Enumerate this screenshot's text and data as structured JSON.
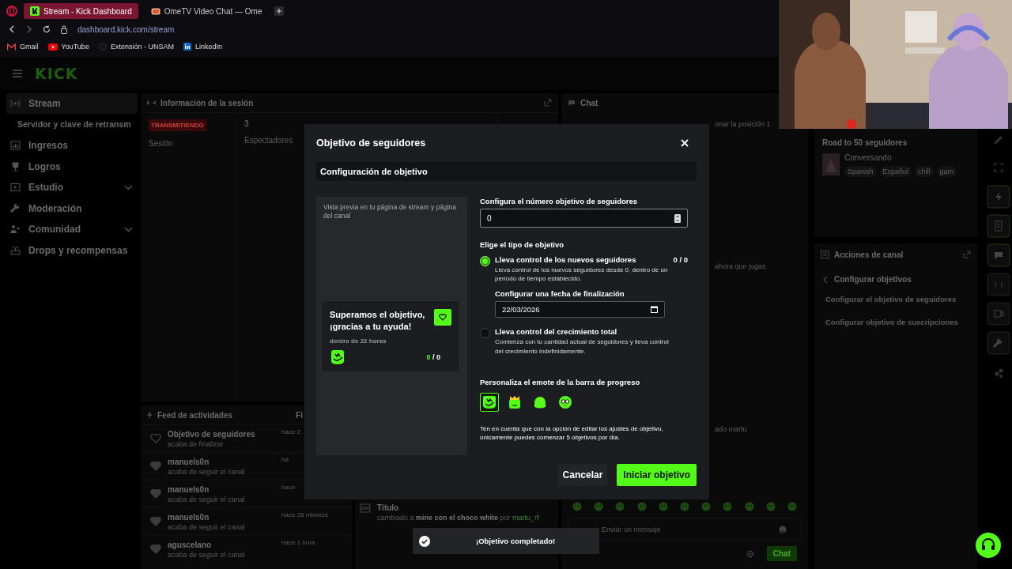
{
  "browser": {
    "tabs": [
      {
        "label": "Stream - Kick Dashboard",
        "selected": true
      },
      {
        "label": "OmeTV Video Chat — Ome",
        "selected": false
      }
    ],
    "url": "dashboard.kick.com/stream",
    "bookmarks": [
      {
        "label": "Gmail",
        "kind": "gmail"
      },
      {
        "label": "YouTube",
        "kind": "youtube"
      },
      {
        "label": "Extensión - UNSAM",
        "kind": "globe"
      },
      {
        "label": "LinkedIn",
        "kind": "linkedin"
      }
    ]
  },
  "header": {
    "logo": "KICK"
  },
  "sidebar": {
    "items": [
      {
        "label": "Stream",
        "kind": "broadcast",
        "selected": true,
        "children": [
          {
            "label": "Servidor y clave de retransm",
            "selected": false
          }
        ]
      },
      {
        "label": "Ingresos",
        "kind": "chart",
        "selected": false
      },
      {
        "label": "Logros",
        "kind": "trophy",
        "selected": false
      },
      {
        "label": "Estudio",
        "kind": "studio",
        "selected": false,
        "expanded": false
      },
      {
        "label": "Moderación",
        "kind": "wrench",
        "selected": false
      },
      {
        "label": "Comunidad",
        "kind": "people",
        "selected": false,
        "expanded": false
      },
      {
        "label": "Drops y recompensas",
        "kind": "gift",
        "selected": false
      }
    ]
  },
  "session": {
    "title": "Información de la sesión",
    "status": "TRANSMITIENDO",
    "status_label": "Sesión",
    "viewers": "3",
    "viewers_label": "Espectadores"
  },
  "feed": {
    "title": "Feed de actividades",
    "filter": "Fi",
    "items": [
      {
        "kind": "goal",
        "title": "Objetivo de seguidores",
        "subtitle": "acaba de finalizar",
        "time": "hace 2"
      },
      {
        "kind": "follow",
        "title": "manuels0n",
        "subtitle": "acaba de seguir el canal",
        "time": "ha"
      },
      {
        "kind": "follow",
        "title": "manuels0n",
        "subtitle": "acaba de seguir el canal",
        "time": "hace"
      },
      {
        "kind": "follow",
        "title": "manuels0n",
        "subtitle": "acaba de seguir el canal",
        "time": "hace 28 minutos"
      },
      {
        "kind": "follow",
        "title": "aguscelano",
        "subtitle": "acaba de seguir el canal",
        "time": "hace 1 hora"
      }
    ]
  },
  "stream_info": {
    "title": "Título",
    "change": "cambiado a **mine con el choco white** por",
    "user": "martu_rf"
  },
  "chat": {
    "title": "Chat",
    "messages": [
      "onar la posición 1",
      "ahora que jugas",
      "ado martu"
    ],
    "placeholder": "Enviar un mensaje",
    "send": "Chat"
  },
  "stream_card": {
    "title": "Road to 50 seguidores",
    "category": "Conversando",
    "tags": [
      "Spanish",
      "Español",
      "chill",
      "gam"
    ]
  },
  "channel_actions": {
    "title": "Acciones de canal",
    "back": "Configurar objetivos",
    "links": [
      "Configurar el objetivo de seguidores",
      "Configurar objetivo de suscripciones"
    ]
  },
  "modal": {
    "title": "Objetivo de seguidores",
    "section": "Configuración de objetivo",
    "preview": {
      "hint": "Vista previa en tu página de stream y página del canal",
      "title": "Superamos el objetivo, ¡gracias a tu ayuda!",
      "time": "dentro de 22 horas",
      "current": "0",
      "total": "/ 0"
    },
    "target": {
      "label": "Configura el número objetivo de seguidores",
      "value": "0"
    },
    "type_label": "Elige el tipo de objetivo",
    "options": [
      {
        "title": "Lleva control de los nuevos seguidores",
        "description": "Lleva control de los nuevos seguidores desde 0, dentro de un período de tiempo establecido.",
        "selected": true,
        "counter": "0 / 0",
        "end_date": {
          "label": "Configurar una fecha de finalización",
          "value": "22/03/2026"
        }
      },
      {
        "title": "Lleva control del crecimiento total",
        "description": "Comienza con tu cantidad actual de seguidores y lleva control del crecimiento indefinidamente.",
        "selected": false
      }
    ],
    "emote_label": "Personaliza el emote de la barra de progreso",
    "emotes": [
      {
        "kind": "logo",
        "selected": true
      },
      {
        "kind": "crown",
        "selected": false
      },
      {
        "kind": "blob",
        "selected": false
      },
      {
        "kind": "glasses",
        "selected": false
      }
    ],
    "note": "Ten en cuenta que con la opción de editar los ajustes de objetivo, únicamente puedes comenzar 5 objetivos por día.",
    "cancel": "Cancelar",
    "confirm": "Iniciar objetivo"
  },
  "toast": {
    "text": "¡Objetivo completado!"
  }
}
